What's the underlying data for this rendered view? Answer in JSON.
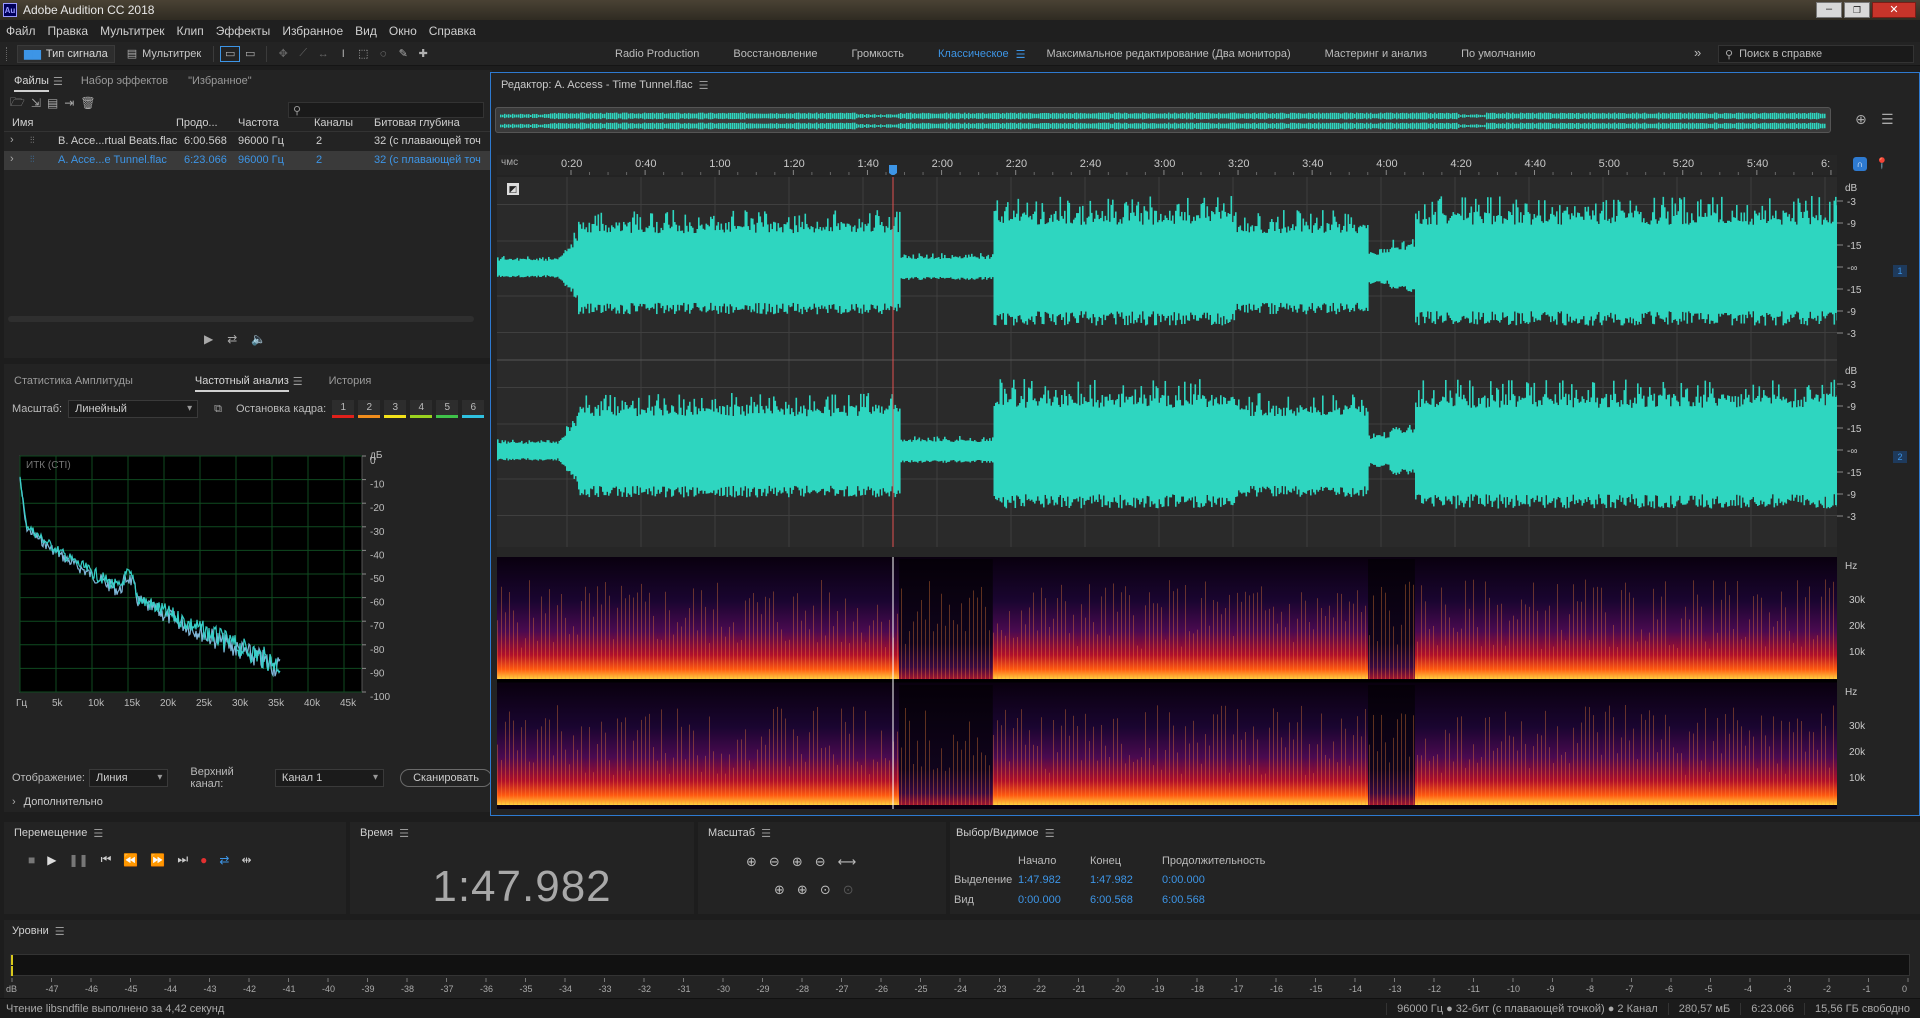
{
  "titlebar": {
    "app_icon": "Au",
    "title": "Adobe Audition CC 2018"
  },
  "menu": [
    "Файл",
    "Правка",
    "Мультитрек",
    "Клип",
    "Эффекты",
    "Избранное",
    "Вид",
    "Окно",
    "Справка"
  ],
  "toolbar": {
    "waveform_btn": "Тип сигнала",
    "multitrack_btn": "Мультитрек",
    "workspaces": [
      "Radio Production",
      "Восстановление",
      "Громкость",
      "Классическое",
      "Максимальное редактирование (Два монитора)",
      "Мастеринг и анализ",
      "По умолчанию"
    ],
    "active_workspace": "Классическое",
    "search_placeholder": "Поиск в справке"
  },
  "files_panel": {
    "tabs": [
      "Файлы",
      "Набор эффектов",
      "\"Избранное\""
    ],
    "columns": [
      "Имя",
      "Продо...",
      "Частота",
      "Каналы",
      "Битовая глубина"
    ],
    "rows": [
      {
        "name": "B. Acce...rtual Beats.flac",
        "duration": "6:00.568",
        "rate": "96000 Гц",
        "channels": "2",
        "depth": "32 (с плавающей точ"
      },
      {
        "name": "A. Acce...e Tunnel.flac",
        "duration": "6:23.066",
        "rate": "96000 Гц",
        "channels": "2",
        "depth": "32 (с плавающей точ"
      }
    ]
  },
  "analysis_panel": {
    "tabs": [
      "Статистика Амплитуды",
      "Частотный анализ",
      "История"
    ],
    "scale_label": "Масштаб:",
    "scale_value": "Линейный",
    "freeze_label": "Остановка кадра:",
    "freeze_slots": [
      "1",
      "2",
      "3",
      "4",
      "5",
      "6"
    ],
    "freeze_colors": [
      "#e0201b",
      "#f08c1c",
      "#f2e21a",
      "#9ad21f",
      "#3fc24a",
      "#2fc1e0"
    ],
    "graph_label": "ИТК (CTI)",
    "db_unit": "дБ",
    "db_ticks": [
      "0",
      "-10",
      "-20",
      "-30",
      "-40",
      "-50",
      "-60",
      "-70",
      "-80",
      "-90",
      "-100"
    ],
    "hz_ticks": [
      "Гц",
      "5k",
      "10k",
      "15k",
      "20k",
      "25k",
      "30k",
      "35k",
      "40k",
      "45k"
    ],
    "display_label": "Отображение:",
    "display_value": "Линия",
    "channel_label": "Верхний канал:",
    "channel_value": "Канал 1",
    "scan_btn": "Сканировать",
    "advanced": "Дополнительно"
  },
  "editor": {
    "title": "Редактор: A. Access - Time Tunnel.flac",
    "ruler_unit": "чмс",
    "ruler_ticks": [
      "0:20",
      "0:40",
      "1:00",
      "1:20",
      "1:40",
      "2:00",
      "2:20",
      "2:40",
      "3:00",
      "3:20",
      "3:40",
      "4:00",
      "4:20",
      "4:40",
      "5:00",
      "5:20",
      "5:40",
      "6:"
    ],
    "db_unit": "dB",
    "db_ticks": [
      "-3",
      "-9",
      "-15",
      "-∞",
      "-15",
      "-9",
      "-3"
    ],
    "channel_badges": [
      "1",
      "2"
    ],
    "hz_unit": "Hz",
    "hz_ticks": [
      "30k",
      "20k",
      "10k"
    ]
  },
  "transport": {
    "title": "Перемещение"
  },
  "time": {
    "title": "Время",
    "value": "1:47.982"
  },
  "zoom": {
    "title": "Масштаб"
  },
  "selection": {
    "title": "Выбор/Видимое",
    "headers": [
      "Начало",
      "Конец",
      "Продолжительность"
    ],
    "rows": [
      {
        "label": "Выделение",
        "start": "1:47.982",
        "end": "1:47.982",
        "duration": "0:00.000"
      },
      {
        "label": "Вид",
        "start": "0:00.000",
        "end": "6:00.568",
        "duration": "6:00.568"
      }
    ]
  },
  "levels": {
    "title": "Уровни",
    "ticks": [
      "dB",
      "-47",
      "-46",
      "-45",
      "-44",
      "-43",
      "-42",
      "-41",
      "-40",
      "-39",
      "-38",
      "-37",
      "-36",
      "-35",
      "-34",
      "-33",
      "-32",
      "-31",
      "-30",
      "-29",
      "-28",
      "-27",
      "-26",
      "-25",
      "-24",
      "-23",
      "-22",
      "-21",
      "-20",
      "-19",
      "-18",
      "-17",
      "-16",
      "-15",
      "-14",
      "-13",
      "-12",
      "-11",
      "-10",
      "-9",
      "-8",
      "-7",
      "-6",
      "-5",
      "-4",
      "-3",
      "-2",
      "-1",
      "0"
    ]
  },
  "status": {
    "left": "Чтение libsndfile выполнено за 4,42 секунд",
    "format": "96000 Гц ● 32-бит (с плавающей точкой) ● 2 Канал",
    "size": "280,57 мБ",
    "duration": "6:23.066",
    "free": "15,56 ГБ свободно"
  }
}
